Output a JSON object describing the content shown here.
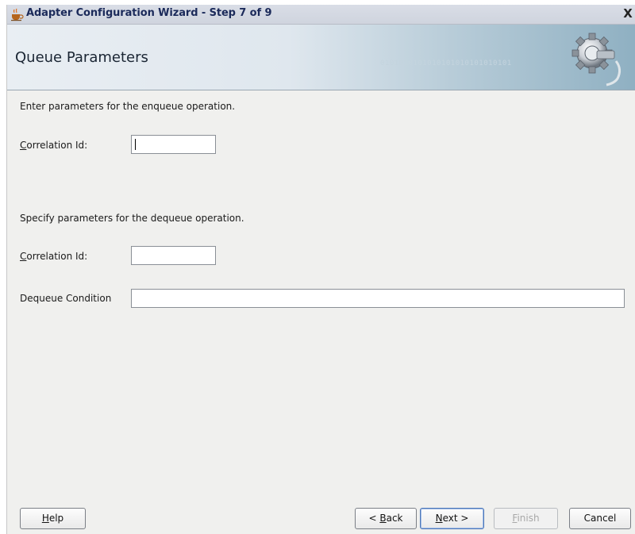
{
  "window": {
    "title": "Adapter Configuration Wizard - Step 7 of 9",
    "close_glyph": "X"
  },
  "banner": {
    "heading": "Queue Parameters",
    "decoration_text": "0101010101010101010101010101"
  },
  "enqueue": {
    "intro": "Enter parameters for the enqueue operation.",
    "correlation_label_mnemonic": "C",
    "correlation_label_rest": "orrelation Id:",
    "correlation_value": ""
  },
  "dequeue": {
    "intro": "Specify parameters for the dequeue operation.",
    "correlation_label_mnemonic": "C",
    "correlation_label_rest": "orrelation Id:",
    "correlation_value": "",
    "condition_label": "Dequeue Condition",
    "condition_value": ""
  },
  "buttons": {
    "help_mnemonic": "H",
    "help_rest": "elp",
    "back_prefix": "< ",
    "back_mnemonic": "B",
    "back_rest": "ack",
    "next_mnemonic": "N",
    "next_rest": "ext >",
    "finish_mnemonic": "F",
    "finish_rest": "inish",
    "cancel_label": "Cancel"
  },
  "colors": {
    "title_text": "#1b2a5a",
    "dialog_background": "#f0f0ee",
    "default_button_border": "#4d77b8"
  }
}
